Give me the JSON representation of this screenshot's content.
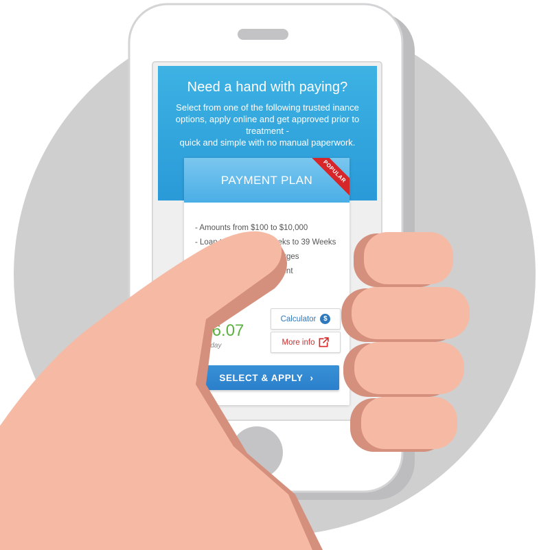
{
  "header": {
    "title": "Need a hand with paying?",
    "subtitle": "Select from one of the following trusted inance\noptions, apply online and get approved prior to\ntreatment -\nquick and simple with no manual paperwork."
  },
  "plan": {
    "title": "PAYMENT PLAN",
    "badge": "POPULAR",
    "features": [
      "- Amounts from $100 to $10,000",
      "- Loan terms from 8 Weeks to 39 Weeks",
      "- No early repayment charges",
      "- Flexible weekly repayment"
    ],
    "price": "$16.07",
    "price_period": "Per day",
    "calculator_label": "Calculator",
    "more_info_label": "More info",
    "apply_label": "SELECT & APPLY",
    "apply_chevron": "›",
    "calculator_icon_glyph": "$"
  },
  "colors": {
    "header_blue": "#2a9ad8",
    "accent_blue": "#2e78bb",
    "price_green": "#5bb240",
    "badge_red": "#d7262a",
    "circle_gray": "#cfcfd0",
    "skin": "#f6b9a4",
    "skin_shadow": "#d48f7d"
  },
  "icons": {
    "calculator": "dollar-circle-icon",
    "more_info": "external-link-icon",
    "apply": "chevron-right-icon"
  }
}
